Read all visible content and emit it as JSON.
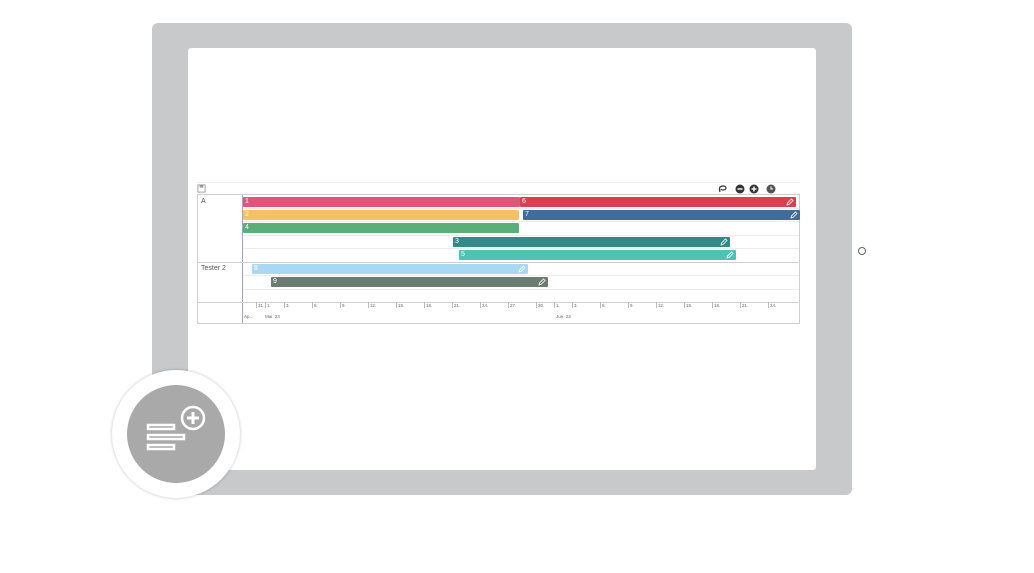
{
  "gantt": {
    "groups": [
      {
        "label": "A"
      },
      {
        "label": "Tester 2"
      }
    ],
    "bars": [
      {
        "num": "1",
        "color": "#e0567a",
        "editable": false
      },
      {
        "num": "6",
        "color": "#d9404f",
        "editable": true
      },
      {
        "num": "2",
        "color": "#f2c265",
        "editable": false
      },
      {
        "num": "7",
        "color": "#3f6d99",
        "editable": true
      },
      {
        "num": "4",
        "color": "#5aae78",
        "editable": false
      },
      {
        "num": "3",
        "color": "#2f8a88",
        "editable": true
      },
      {
        "num": "5",
        "color": "#4fc2b4",
        "editable": true
      },
      {
        "num": "8",
        "color": "#a8d8f2",
        "editable": true
      },
      {
        "num": "9",
        "color": "#6b7d6f",
        "editable": true
      }
    ],
    "ticks": [
      "31.",
      "1.",
      "3.",
      "6.",
      "9.",
      "12.",
      "15.",
      "18.",
      "21.",
      "24.",
      "27.",
      "30.",
      "1.",
      "3.",
      "6.",
      "9.",
      "12.",
      "15.",
      "18.",
      "21.",
      "24."
    ],
    "months": [
      "Ap...",
      "Mai. 23",
      "Jun. 23"
    ]
  },
  "toolbar": {
    "icons": [
      "save-icon",
      "lasso-icon",
      "zoom-out-icon",
      "zoom-in-icon",
      "clock-icon"
    ]
  },
  "fab": {
    "icon": "add-list-icon"
  }
}
